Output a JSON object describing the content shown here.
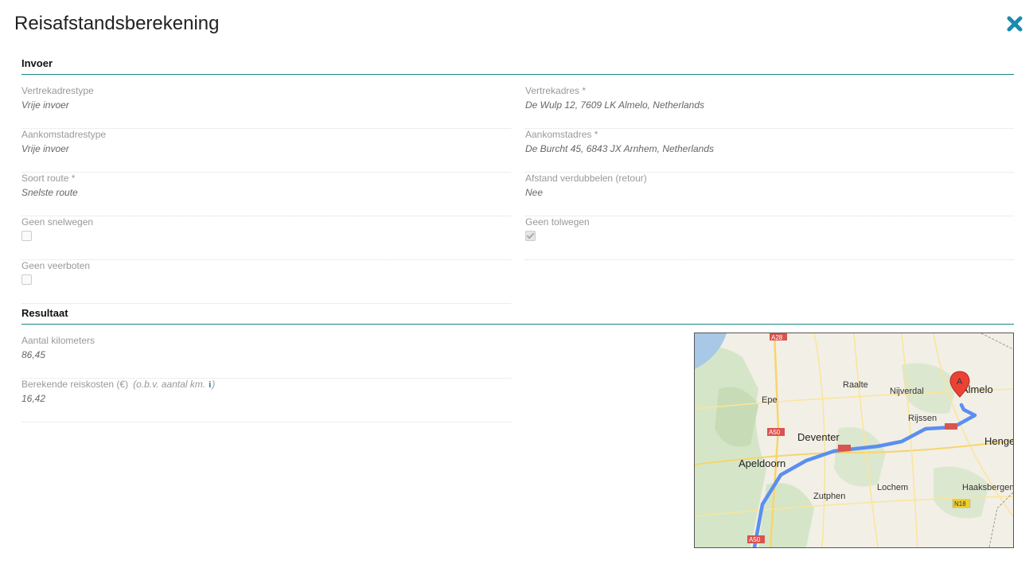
{
  "dialog": {
    "title": "Reisafstandsberekening"
  },
  "invoer": {
    "heading": "Invoer",
    "vertrekadrestype": {
      "label": "Vertrekadrestype",
      "value": "Vrije invoer"
    },
    "vertrekadres": {
      "label": "Vertrekadres *",
      "value": "De Wulp 12, 7609 LK Almelo, Netherlands"
    },
    "aankomstadrestype": {
      "label": "Aankomstadrestype",
      "value": "Vrije invoer"
    },
    "aankomstadres": {
      "label": "Aankomstadres *",
      "value": "De Burcht 45, 6843 JX Arnhem, Netherlands"
    },
    "soort_route": {
      "label": "Soort route *",
      "value": "Snelste route"
    },
    "afstand_verdubbelen": {
      "label": "Afstand verdubbelen (retour)",
      "value": "Nee"
    },
    "geen_snelwegen": {
      "label": "Geen snelwegen",
      "checked": false
    },
    "geen_tolwegen": {
      "label": "Geen tolwegen",
      "checked": true
    },
    "geen_veerboten": {
      "label": "Geen veerboten",
      "checked": false
    }
  },
  "resultaat": {
    "heading": "Resultaat",
    "aantal_km": {
      "label": "Aantal kilometers",
      "value": "86,45"
    },
    "reiskosten": {
      "label": "Berekende reiskosten (€)",
      "hint": "(o.b.v. aantal km.",
      "hint_close": ")",
      "value": "16,42"
    }
  },
  "map": {
    "places": [
      "Raalte",
      "Nijverdal",
      "Almelo",
      "Epe",
      "Rijssen",
      "Deventer",
      "Hengelo",
      "Apeldoorn",
      "Lochem",
      "Haaksbergen",
      "Zutphen"
    ],
    "road_shields": [
      "A28",
      "A50",
      "N18",
      "A50"
    ],
    "marker_label": "A",
    "route_color": "#5b8ef0"
  }
}
